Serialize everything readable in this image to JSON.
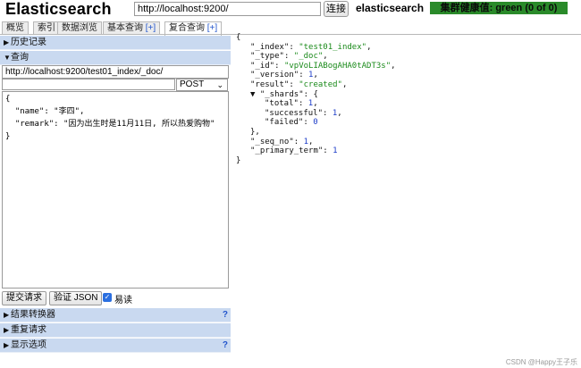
{
  "header": {
    "logo": "Elasticsearch",
    "url_value": "http://localhost:9200/",
    "connect_label": "连接",
    "cluster_name": "elasticsearch",
    "health_text": "集群健康值: green (0 of 0)",
    "health_color": "#2a8a2a"
  },
  "tabs": [
    {
      "label": "概览",
      "plus": ""
    },
    {
      "label": "索引",
      "plus": ""
    },
    {
      "label": "数据浏览",
      "plus": ""
    },
    {
      "label": "基本查询",
      "plus": "[+]"
    },
    {
      "label": "复合查询",
      "plus": "[+]"
    }
  ],
  "active_tab": 4,
  "left": {
    "history_label": "历史记录",
    "query_label": "查询",
    "query_url": "http://localhost:9200/test01_index/_doc/",
    "path_value": "",
    "method": "POST",
    "body": "{\n  \"name\": \"李四\",\n  \"remark\": \"因为出生时是11月11日, 所以热爱购物\"\n}",
    "submit_label": "提交请求",
    "validate_label": "验证 JSON",
    "pretty_label": "易读",
    "pretty_checked": true,
    "transformer_label": "结果转换器",
    "repeat_label": "重复请求",
    "display_label": "显示选项",
    "help": "?"
  },
  "response": {
    "lines": [
      {
        "indent": 0,
        "parts": [
          [
            "p",
            "{"
          ]
        ]
      },
      {
        "indent": 1,
        "parts": [
          [
            "k",
            "\"_index\""
          ],
          [
            "p",
            ": "
          ],
          [
            "s",
            "\"test01_index\""
          ],
          [
            "p",
            ","
          ]
        ]
      },
      {
        "indent": 1,
        "parts": [
          [
            "k",
            "\"_type\""
          ],
          [
            "p",
            ": "
          ],
          [
            "s",
            "\"_doc\""
          ],
          [
            "p",
            ","
          ]
        ]
      },
      {
        "indent": 1,
        "parts": [
          [
            "k",
            "\"_id\""
          ],
          [
            "p",
            ": "
          ],
          [
            "s",
            "\"vpVoLIABogAHA0tADT3s\""
          ],
          [
            "p",
            ","
          ]
        ]
      },
      {
        "indent": 1,
        "parts": [
          [
            "k",
            "\"_version\""
          ],
          [
            "p",
            ": "
          ],
          [
            "n",
            "1"
          ],
          [
            "p",
            ","
          ]
        ]
      },
      {
        "indent": 1,
        "parts": [
          [
            "k",
            "\"result\""
          ],
          [
            "p",
            ": "
          ],
          [
            "s",
            "\"created\""
          ],
          [
            "p",
            ","
          ]
        ]
      },
      {
        "indent": 1,
        "parts": [
          [
            "p",
            "▼ "
          ],
          [
            "k",
            "\"_shards\""
          ],
          [
            "p",
            ": {"
          ]
        ]
      },
      {
        "indent": 2,
        "parts": [
          [
            "k",
            "\"total\""
          ],
          [
            "p",
            ": "
          ],
          [
            "n",
            "1"
          ],
          [
            "p",
            ","
          ]
        ]
      },
      {
        "indent": 2,
        "parts": [
          [
            "k",
            "\"successful\""
          ],
          [
            "p",
            ": "
          ],
          [
            "n",
            "1"
          ],
          [
            "p",
            ","
          ]
        ]
      },
      {
        "indent": 2,
        "parts": [
          [
            "k",
            "\"failed\""
          ],
          [
            "p",
            ": "
          ],
          [
            "n",
            "0"
          ]
        ]
      },
      {
        "indent": 1,
        "parts": [
          [
            "p",
            "},"
          ]
        ]
      },
      {
        "indent": 1,
        "parts": [
          [
            "k",
            "\"_seq_no\""
          ],
          [
            "p",
            ": "
          ],
          [
            "n",
            "1"
          ],
          [
            "p",
            ","
          ]
        ]
      },
      {
        "indent": 1,
        "parts": [
          [
            "k",
            "\"_primary_term\""
          ],
          [
            "p",
            ": "
          ],
          [
            "n",
            "1"
          ]
        ]
      },
      {
        "indent": 0,
        "parts": [
          [
            "p",
            "}"
          ]
        ]
      }
    ]
  },
  "watermark": "CSDN @Happy王子乐"
}
